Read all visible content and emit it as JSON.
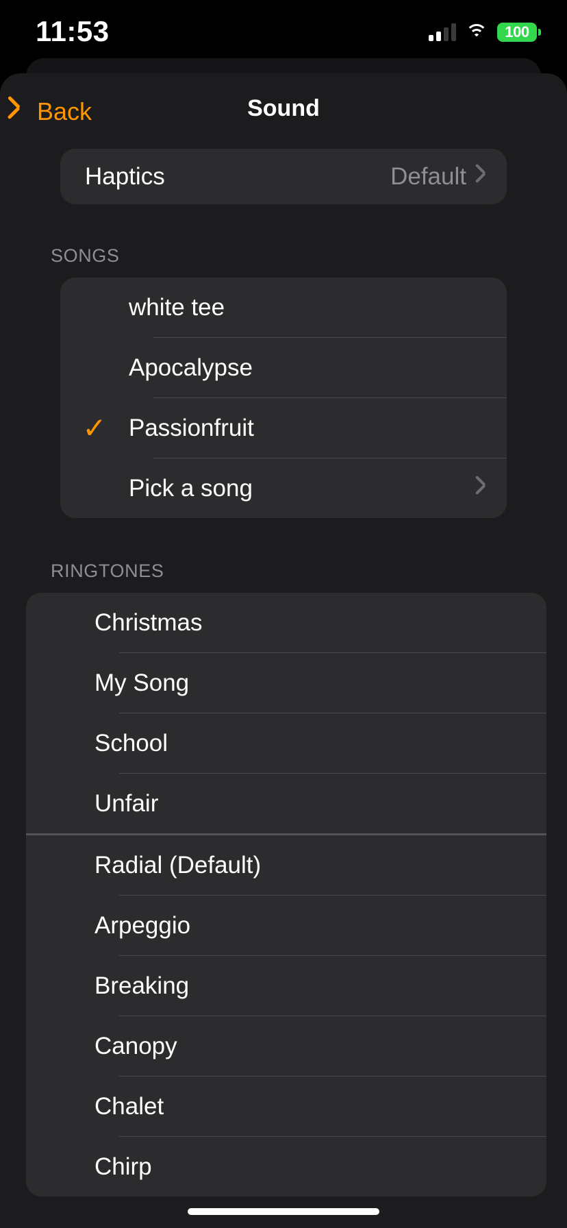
{
  "status_bar": {
    "time": "11:53",
    "battery_percent": "100",
    "battery_color": "#32D74B",
    "signal_bars_filled": 2,
    "signal_bars_total": 4,
    "wifi_icon": "wifi-icon"
  },
  "nav": {
    "back_label": "Back",
    "title": "Sound",
    "accent_color": "#FF9500"
  },
  "haptics": {
    "label": "Haptics",
    "value": "Default"
  },
  "songs_section": {
    "header": "SONGS",
    "items": [
      {
        "label": "white tee",
        "selected": false,
        "disclosure": false
      },
      {
        "label": "Apocalypse",
        "selected": false,
        "disclosure": false
      },
      {
        "label": "Passionfruit",
        "selected": true,
        "disclosure": false
      },
      {
        "label": "Pick a song",
        "selected": false,
        "disclosure": true
      }
    ]
  },
  "ringtones_section": {
    "header": "RINGTONES",
    "custom_items": [
      {
        "label": "Christmas",
        "selected": false
      },
      {
        "label": "My Song",
        "selected": false
      },
      {
        "label": "School",
        "selected": false
      },
      {
        "label": "Unfair",
        "selected": false
      }
    ],
    "system_items": [
      {
        "label": "Radial (Default)",
        "selected": false
      },
      {
        "label": "Arpeggio",
        "selected": false
      },
      {
        "label": "Breaking",
        "selected": false
      },
      {
        "label": "Canopy",
        "selected": false
      },
      {
        "label": "Chalet",
        "selected": false
      },
      {
        "label": "Chirp",
        "selected": false
      }
    ]
  },
  "checkmark_glyph": "✓"
}
